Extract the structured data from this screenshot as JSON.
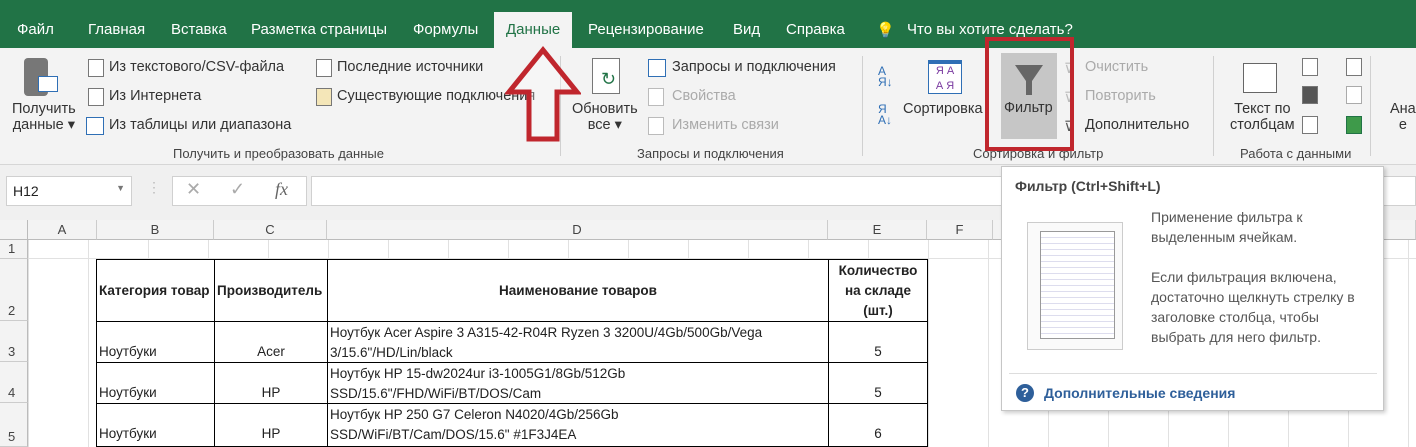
{
  "tabs": [
    "Файл",
    "Главная",
    "Вставка",
    "Разметка страницы",
    "Формулы",
    "Данные",
    "Рецензирование",
    "Вид",
    "Справка"
  ],
  "active_tab": "Данные",
  "tell_me": "Что вы хотите сделать?",
  "ribbon": {
    "get_data": {
      "line1": "Получить",
      "line2": "данные"
    },
    "from_csv": "Из текстового/CSV-файла",
    "from_web": "Из Интернета",
    "from_table": "Из таблицы или диапазона",
    "recent_sources": "Последние источники",
    "existing_connections": "Существующие подключения",
    "group1": "Получить и преобразовать данные",
    "refresh": {
      "line1": "Обновить",
      "line2": "все"
    },
    "queries": "Запросы и подключения",
    "properties": "Свойства",
    "edit_links": "Изменить связи",
    "group2": "Запросы и подключения",
    "sort": "Сортировка",
    "filter": "Фильтр",
    "clear": "Очистить",
    "reapply": "Повторить",
    "advanced": "Дополнительно",
    "group3": "Сортировка и фильтр",
    "text_to_columns": {
      "line1": "Текст по",
      "line2": "столбцам"
    },
    "group4": "Работа с данными",
    "analysis_partial": {
      "line1": "Ана",
      "line2": "е"
    }
  },
  "formula_bar": {
    "name_box": "H12",
    "fx": "fx",
    "value": ""
  },
  "columns": [
    "A",
    "B",
    "C",
    "D",
    "E",
    "F"
  ],
  "rows": [
    "1",
    "2",
    "3",
    "4",
    "5"
  ],
  "table": {
    "headers": [
      "Категория товар",
      "Производитель",
      "Наименование товаров",
      "Количество на складе (шт.)"
    ],
    "data": [
      {
        "category": "Ноутбуки",
        "maker": "Acer",
        "name1": "Ноутбук Acer Aspire 3 A315-42-R04R Ryzen 3 3200U/4Gb/500Gb/Vega",
        "name2": "3/15.6\"/HD/Lin/black",
        "qty": "5"
      },
      {
        "category": "Ноутбуки",
        "maker": "HP",
        "name1": "Ноутбук HP 15-dw2024ur i3-1005G1/8Gb/512Gb",
        "name2": "SSD/15.6\"/FHD/WiFi/BT/DOS/Cam",
        "qty": "5"
      },
      {
        "category": "Ноутбуки",
        "maker": "HP",
        "name1": "Ноутбук HP 250 G7 Celeron N4020/4Gb/256Gb",
        "name2": "SSD/WiFi/BT/Cam/DOS/15.6\" #1F3J4EA",
        "qty": "6"
      }
    ]
  },
  "tooltip": {
    "title": "Фильтр (Ctrl+Shift+L)",
    "p1": "Применение фильтра к выделенным ячейкам.",
    "p2": "Если фильтрация включена, достаточно щелкнуть стрелку в заголовке столбца, чтобы выбрать для него фильтр.",
    "more": "Дополнительные сведения"
  },
  "colors": {
    "excel_green": "#217346",
    "highlight_red": "#c0262d",
    "link_blue": "#2e5f9a"
  }
}
